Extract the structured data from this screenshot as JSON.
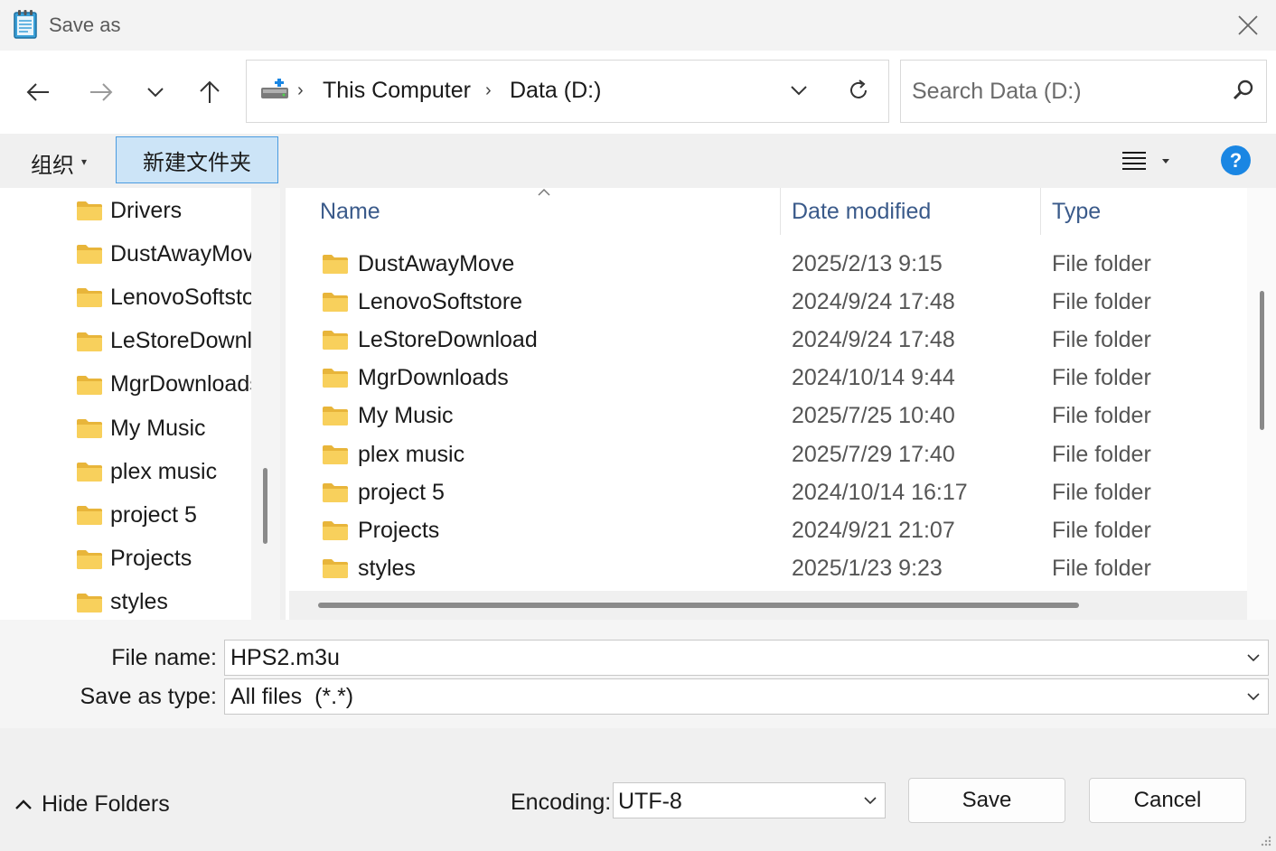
{
  "window": {
    "title": "Save as",
    "app_icon": "notepad-icon",
    "close_icon": "close-icon"
  },
  "nav": {
    "back_icon": "arrow-left-icon",
    "forward_icon": "arrow-right-icon",
    "recent_icon": "chevron-down-icon",
    "up_icon": "arrow-up-icon"
  },
  "address": {
    "drive_icon": "drive-icon",
    "crumbs": [
      "This Computer",
      "Data (D:)"
    ],
    "separator": "›",
    "refresh_icon": "refresh-icon"
  },
  "search": {
    "placeholder": "Search Data (D:)",
    "icon": "search-icon"
  },
  "toolbar": {
    "organize_label": "组织",
    "organize_caret": "▾",
    "new_folder_label": "新建文件夹",
    "view_icon": "view-list-icon",
    "help_label": "?"
  },
  "tree": {
    "items": [
      {
        "label": "Drivers"
      },
      {
        "label": "DustAwayMove"
      },
      {
        "label": "LenovoSoftstore"
      },
      {
        "label": "LeStoreDownload"
      },
      {
        "label": "MgrDownloads"
      },
      {
        "label": "My Music"
      },
      {
        "label": "plex music"
      },
      {
        "label": "project 5"
      },
      {
        "label": "Projects"
      },
      {
        "label": "styles"
      }
    ]
  },
  "columns": {
    "name": "Name",
    "date": "Date modified",
    "type": "Type"
  },
  "files": [
    {
      "name": "DustAwayMove",
      "date": "2025/2/13 9:15",
      "type": "File folder"
    },
    {
      "name": "LenovoSoftstore",
      "date": "2024/9/24 17:48",
      "type": "File folder"
    },
    {
      "name": "LeStoreDownload",
      "date": "2024/9/24 17:48",
      "type": "File folder"
    },
    {
      "name": "MgrDownloads",
      "date": "2024/10/14 9:44",
      "type": "File folder"
    },
    {
      "name": "My Music",
      "date": "2025/7/25 10:40",
      "type": "File folder"
    },
    {
      "name": "plex music",
      "date": "2025/7/29 17:40",
      "type": "File folder"
    },
    {
      "name": "project 5",
      "date": "2024/10/14 16:17",
      "type": "File folder"
    },
    {
      "name": "Projects",
      "date": "2024/9/21 21:07",
      "type": "File folder"
    },
    {
      "name": "styles",
      "date": "2025/1/23 9:23",
      "type": "File folder"
    }
  ],
  "form": {
    "file_name_label": "File name:",
    "file_name_value": "HPS2.m3u",
    "save_type_label": "Save as type:",
    "save_type_value": "All files  (*.*)"
  },
  "footer": {
    "hide_folders_label": "Hide Folders",
    "encoding_label": "Encoding:",
    "encoding_value": "UTF-8",
    "save_label": "Save",
    "cancel_label": "Cancel"
  },
  "colors": {
    "accent": "#1a86e3",
    "folder": "#f6c945",
    "selected_button": "#cce4f7"
  }
}
